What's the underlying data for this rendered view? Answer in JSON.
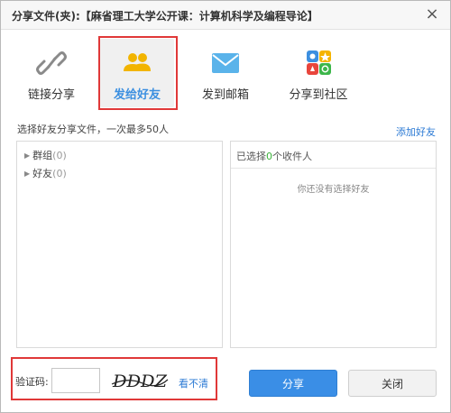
{
  "dialog": {
    "title": "分享文件(夹):【麻省理工大学公开课：计算机科学及编程导论】",
    "close_glyph": "×"
  },
  "share_options": [
    {
      "label": "链接分享",
      "icon": "link-icon"
    },
    {
      "label": "发给好友",
      "icon": "friends-icon",
      "selected": true
    },
    {
      "label": "发到邮箱",
      "icon": "email-icon"
    },
    {
      "label": "分享到社区",
      "icon": "community-icon"
    }
  ],
  "friends": {
    "hint": "选择好友分享文件，一次最多50人",
    "add_friend_link": "添加好友",
    "groups": [
      {
        "label": "群组",
        "count": "(0)"
      },
      {
        "label": "好友",
        "count": "(0)"
      }
    ]
  },
  "recipients": {
    "header_prefix": "已选择",
    "selected_count": "0",
    "header_suffix": "个收件人",
    "empty_text": "你还没有选择好友"
  },
  "captcha": {
    "label": "验证码:",
    "value": "",
    "image_text": "DDDZ",
    "refresh_link": "看不清"
  },
  "buttons": {
    "share": "分享",
    "close": "关闭"
  },
  "colors": {
    "accent": "#3a8ee6",
    "link": "#2a79d4",
    "highlight_box": "#e03838",
    "count_green": "#3ab13a"
  }
}
